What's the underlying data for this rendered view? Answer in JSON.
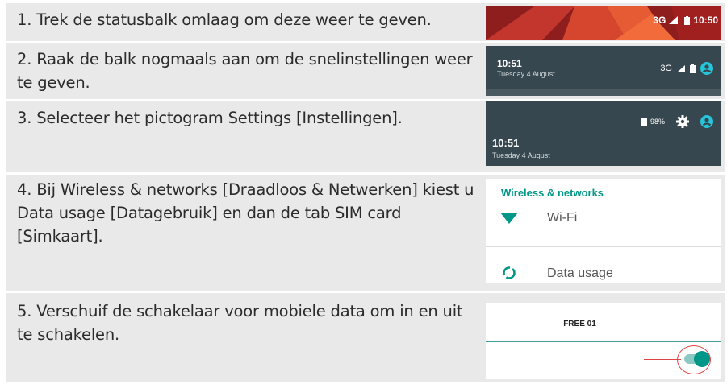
{
  "steps": [
    {
      "text": "1. Trek de statusbalk omlaag om deze weer te geven."
    },
    {
      "text": "2. Raak de balk nogmaals aan om de snelinstellingen weer te geven."
    },
    {
      "text": "3. Selecteer het pictogram Settings [Instellingen]."
    },
    {
      "text": "4. Bij Wireless & networks [Draadloos & Netwerken] kiest u Data usage [Datagebruik] en dan de tab SIM card [Simkaart]."
    },
    {
      "text": "5. Verschuif de schakelaar voor mobiele data om in en uit te schakelen."
    }
  ],
  "shot1": {
    "network": "3G",
    "time": "10:50"
  },
  "shot2": {
    "time": "10:51",
    "date": "Tuesday 4 August",
    "network": "3G"
  },
  "shot3": {
    "battery": "98%",
    "time": "10:51",
    "date": "Tuesday 4 August"
  },
  "shot4": {
    "section": "Wireless & networks",
    "items": [
      "Wi-Fi",
      "Data usage"
    ]
  },
  "shot5": {
    "tab": "FREE 01",
    "toggle_on": true
  },
  "colors": {
    "accent": "#009688",
    "status_dark": "#37474f",
    "highlight": "#e04444"
  },
  "icons": [
    "signal-icon",
    "battery-icon",
    "account-icon",
    "gear-icon",
    "wifi-icon",
    "data-usage-icon"
  ]
}
